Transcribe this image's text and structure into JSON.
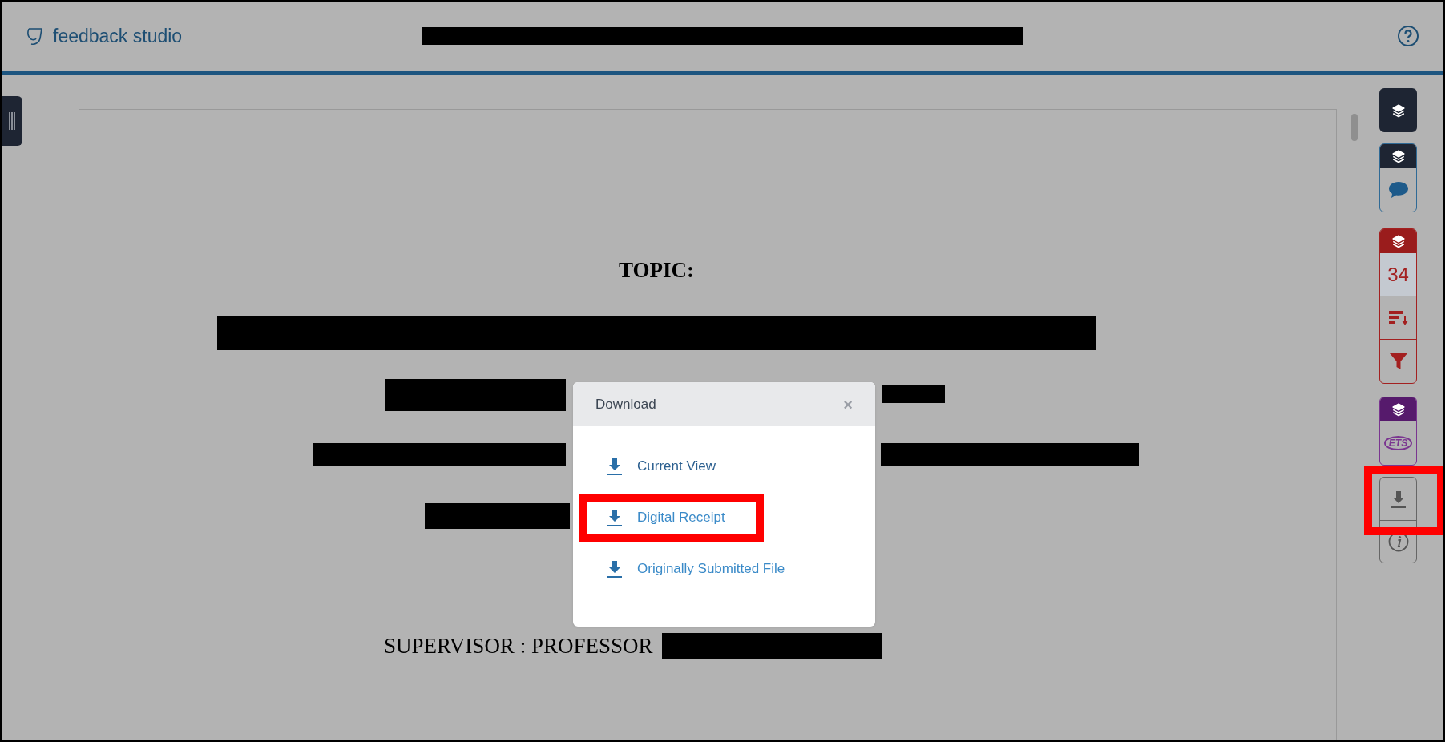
{
  "header": {
    "logo_text": "feedback studio"
  },
  "document": {
    "heading": "TOPIC:",
    "supervisor": "SUPERVISOR : PROFESSOR"
  },
  "toolbar": {
    "groups": [
      {
        "kind": "single",
        "color": "#1e2533"
      },
      {
        "kind": "comments",
        "color": "#1e2533"
      },
      {
        "kind": "similarity",
        "color": "#9a1c1c",
        "count": "34"
      },
      {
        "kind": "grammar",
        "color": "#561a6c",
        "logo": "ETS"
      }
    ],
    "download_button": {
      "highlighted": true
    }
  },
  "download_dialog": {
    "title": "Download",
    "close": "×",
    "options": [
      {
        "label": "Current View",
        "highlighted": false
      },
      {
        "label": "Digital Receipt",
        "highlighted": true
      },
      {
        "label": "Originally Submitted File",
        "highlighted": false
      }
    ]
  }
}
